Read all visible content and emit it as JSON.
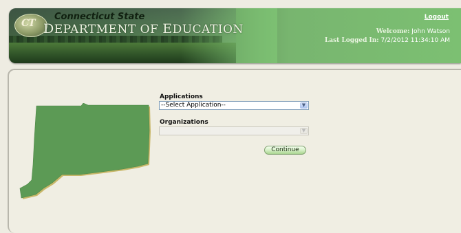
{
  "header": {
    "logo_text": "CT",
    "state_title": "Connecticut State",
    "dept_title": "Department of Education",
    "logout_label": "Logout",
    "welcome_label": "Welcome:",
    "welcome_name": "John Watson",
    "last_logged_label": "Last Logged In:",
    "last_logged_value": "7/2/2012 11:34:10 AM"
  },
  "form": {
    "applications_label": "Applications",
    "applications_selected": "--Select Application--",
    "organizations_label": "Organizations",
    "organizations_selected": "",
    "continue_label": "Continue"
  },
  "colors": {
    "accent_green": "#7cc072",
    "map_green": "#5c9a55",
    "map_shadow": "#c9b86a"
  },
  "icons": {
    "dropdown_arrow": "chevron-down-icon",
    "state_map": "connecticut-map-icon"
  }
}
